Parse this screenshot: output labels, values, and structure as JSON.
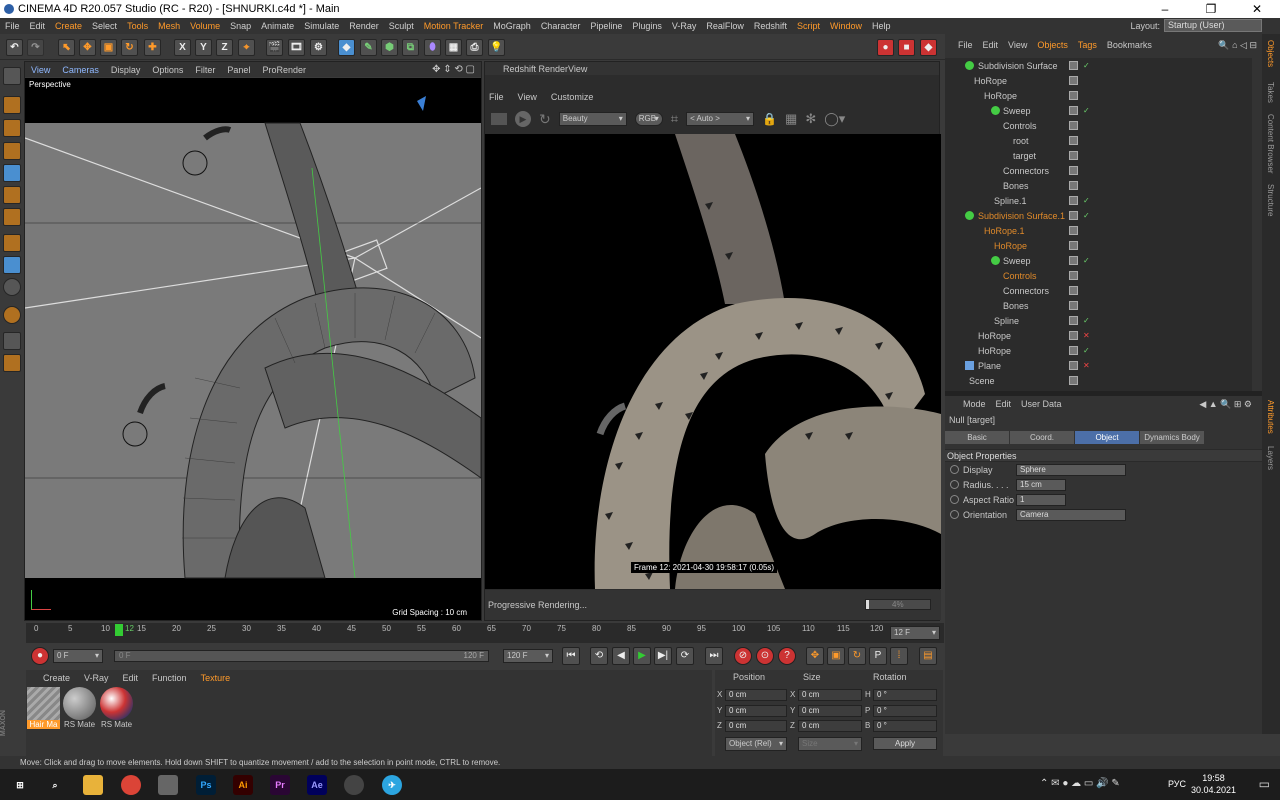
{
  "titlebar": {
    "title": "CINEMA 4D R20.057 Studio (RC - R20) - [SHNURKI.c4d *] - Main",
    "minimize": "–",
    "maximize": "❐",
    "close": "✕"
  },
  "menu": [
    "File",
    "Edit",
    "Create",
    "Select",
    "Tools",
    "Mesh",
    "Volume",
    "Snap",
    "Animate",
    "Simulate",
    "Render",
    "Sculpt",
    "Motion Tracker",
    "MoGraph",
    "Character",
    "Pipeline",
    "Plugins",
    "V-Ray",
    "RealFlow",
    "Redshift",
    "Script",
    "Window",
    "Help"
  ],
  "layout": {
    "label": "Layout:",
    "value": "Startup (User)"
  },
  "viewport": {
    "menu": [
      "View",
      "Cameras",
      "Display",
      "Options",
      "Filter",
      "Panel",
      "ProRender"
    ],
    "camera_label": "Perspective",
    "grid_spacing": "Grid Spacing : 10 cm"
  },
  "renderview": {
    "title": "Redshift RenderView",
    "menu": [
      "File",
      "View",
      "Customize"
    ],
    "aov": "Beauty",
    "rgb": "RGB",
    "auto": "< Auto >",
    "frame_info": "Frame  12:  2021-04-30  19:58:17  (0.05s)",
    "progress_text": "Progressive Rendering...",
    "progress_pct": "4%"
  },
  "object_manager": {
    "menu": [
      "File",
      "Edit",
      "View",
      "Objects",
      "Tags",
      "Bookmarks"
    ],
    "rows": [
      {
        "name": "Subdivision Surface",
        "indent": 1,
        "orange": false,
        "tag": "ok"
      },
      {
        "name": "HoRope",
        "indent": 2,
        "orange": false,
        "tag": ""
      },
      {
        "name": "HoRope",
        "indent": 3,
        "orange": false,
        "tag": ""
      },
      {
        "name": "Sweep",
        "indent": 4,
        "orange": false,
        "tag": "ok"
      },
      {
        "name": "Controls",
        "indent": 4,
        "orange": false,
        "tag": ""
      },
      {
        "name": "root",
        "indent": 5,
        "orange": false,
        "tag": ""
      },
      {
        "name": "target",
        "indent": 5,
        "orange": false,
        "tag": ""
      },
      {
        "name": "Connectors",
        "indent": 4,
        "orange": false,
        "tag": ""
      },
      {
        "name": "Bones",
        "indent": 4,
        "orange": false,
        "tag": ""
      },
      {
        "name": "Spline.1",
        "indent": 3,
        "orange": false,
        "tag": "ok"
      },
      {
        "name": "Subdivision Surface.1",
        "indent": 1,
        "orange": true,
        "tag": "ok"
      },
      {
        "name": "HoRope.1",
        "indent": 2,
        "orange": true,
        "tag": ""
      },
      {
        "name": "HoRope",
        "indent": 3,
        "orange": true,
        "tag": ""
      },
      {
        "name": "Sweep",
        "indent": 4,
        "orange": false,
        "tag": "ok"
      },
      {
        "name": "Controls",
        "indent": 4,
        "orange": true,
        "tag": ""
      },
      {
        "name": "Connectors",
        "indent": 4,
        "orange": false,
        "tag": ""
      },
      {
        "name": "Bones",
        "indent": 4,
        "orange": false,
        "tag": ""
      },
      {
        "name": "Spline",
        "indent": 3,
        "orange": false,
        "tag": "ok"
      },
      {
        "name": "HoRope",
        "indent": 1,
        "orange": false,
        "tag": "x"
      },
      {
        "name": "HoRope",
        "indent": 1,
        "orange": false,
        "tag": "ok"
      },
      {
        "name": "Plane",
        "indent": 1,
        "orange": false,
        "tag": "x"
      },
      {
        "name": "Scene",
        "indent": 0,
        "orange": false,
        "tag": ""
      }
    ]
  },
  "attributes": {
    "menu": [
      "Mode",
      "Edit",
      "User Data"
    ],
    "object_name": "Null [target]",
    "tabs": [
      "Basic",
      "Coord.",
      "Object",
      "Dynamics Body"
    ],
    "active_tab": "Object",
    "section": "Object Properties",
    "props": [
      {
        "label": "Display",
        "value": "Sphere"
      },
      {
        "label": "Radius. . . .",
        "value": "15 cm"
      },
      {
        "label": "Aspect Ratio",
        "value": "1"
      },
      {
        "label": "Orientation",
        "value": "Camera"
      }
    ]
  },
  "side_tabs": [
    "Objects",
    "Takes",
    "Content Browser",
    "Structure",
    "Attributes",
    "Layers"
  ],
  "timeline": {
    "ticks": [
      "0",
      "5",
      "10",
      "15",
      "20",
      "25",
      "30",
      "35",
      "40",
      "45",
      "50",
      "55",
      "60",
      "65",
      "70",
      "75",
      "80",
      "85",
      "90",
      "95",
      "100",
      "105",
      "110",
      "115",
      "120"
    ],
    "current": "12",
    "current_frame_field": "12 F"
  },
  "playback": {
    "start": "0 F",
    "slider_start": "0 F",
    "slider_end": "120 F",
    "end": "120 F"
  },
  "materials": {
    "menu": [
      "Create",
      "V-Ray",
      "Edit",
      "Function",
      "Texture"
    ],
    "items": [
      "Hair Ma",
      "RS Mate",
      "RS Mate"
    ]
  },
  "coords": {
    "headers": [
      "Position",
      "Size",
      "Rotation"
    ],
    "rows": [
      {
        "axis": "X",
        "pos": "0 cm",
        "saxis": "X",
        "size": "0 cm",
        "raxis": "H",
        "rot": "0 °"
      },
      {
        "axis": "Y",
        "pos": "0 cm",
        "saxis": "Y",
        "size": "0 cm",
        "raxis": "P",
        "rot": "0 °"
      },
      {
        "axis": "Z",
        "pos": "0 cm",
        "saxis": "Z",
        "size": "0 cm",
        "raxis": "B",
        "rot": "0 °"
      }
    ],
    "mode": "Object (Rel)",
    "size_mode": "Size",
    "apply": "Apply"
  },
  "status": "Move: Click and drag to move elements. Hold down SHIFT to quantize movement / add to the selection in point mode, CTRL to remove.",
  "taskbar": {
    "lang": "РУС",
    "time": "19:58",
    "date": "30.04.2021"
  },
  "colors": {
    "accent_orange": "#ff9a2a",
    "active_tab": "#4c6fa8",
    "ok": "#6bd06b",
    "bad": "#e44"
  }
}
